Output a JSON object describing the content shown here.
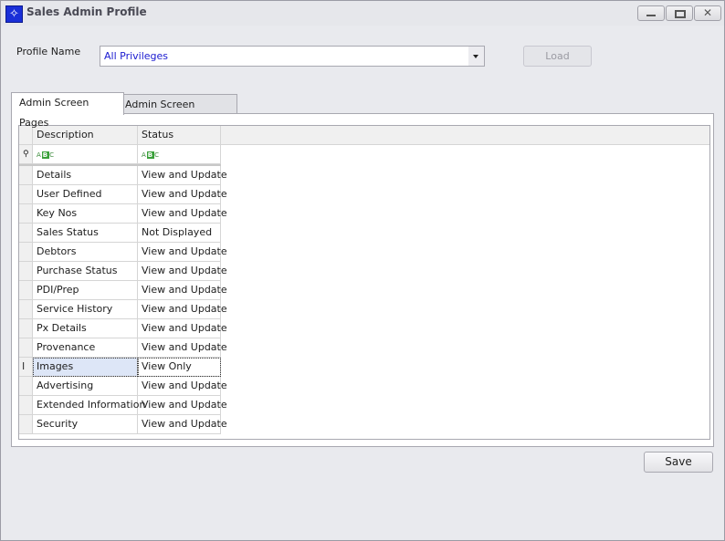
{
  "window": {
    "title": "Sales Admin Profile",
    "icon": "compass-star-icon",
    "controls": {
      "minimize": "minimize",
      "maximize": "maximize",
      "close": "✕"
    }
  },
  "profile": {
    "label": "Profile Name",
    "value": "All Privileges",
    "load_label": "Load"
  },
  "tabs": [
    {
      "label": "Admin Screen Pages",
      "active": true
    },
    {
      "label": "Admin Screen Functions",
      "active": false
    }
  ],
  "grid": {
    "columns": [
      "Description",
      "Status"
    ],
    "filter_icon": "abc-filter-icon",
    "rows": [
      {
        "description": "Details",
        "status": "View and Update"
      },
      {
        "description": "User Defined",
        "status": "View and Update"
      },
      {
        "description": "Key Nos",
        "status": "View and Update"
      },
      {
        "description": "Sales Status",
        "status": "Not Displayed"
      },
      {
        "description": "Debtors",
        "status": "View and Update"
      },
      {
        "description": "Purchase Status",
        "status": "View and Update"
      },
      {
        "description": "PDI/Prep",
        "status": "View and Update"
      },
      {
        "description": "Service History",
        "status": "View and Update"
      },
      {
        "description": "Px Details",
        "status": "View and Update"
      },
      {
        "description": "Provenance",
        "status": "View and Update"
      },
      {
        "description": "Images",
        "status": "View Only",
        "selected": true
      },
      {
        "description": "Advertising",
        "status": "View and Update"
      },
      {
        "description": "Extended Information",
        "status": "View and Update"
      },
      {
        "description": "Security",
        "status": "View and Update"
      }
    ]
  },
  "footer": {
    "save_label": "Save"
  }
}
